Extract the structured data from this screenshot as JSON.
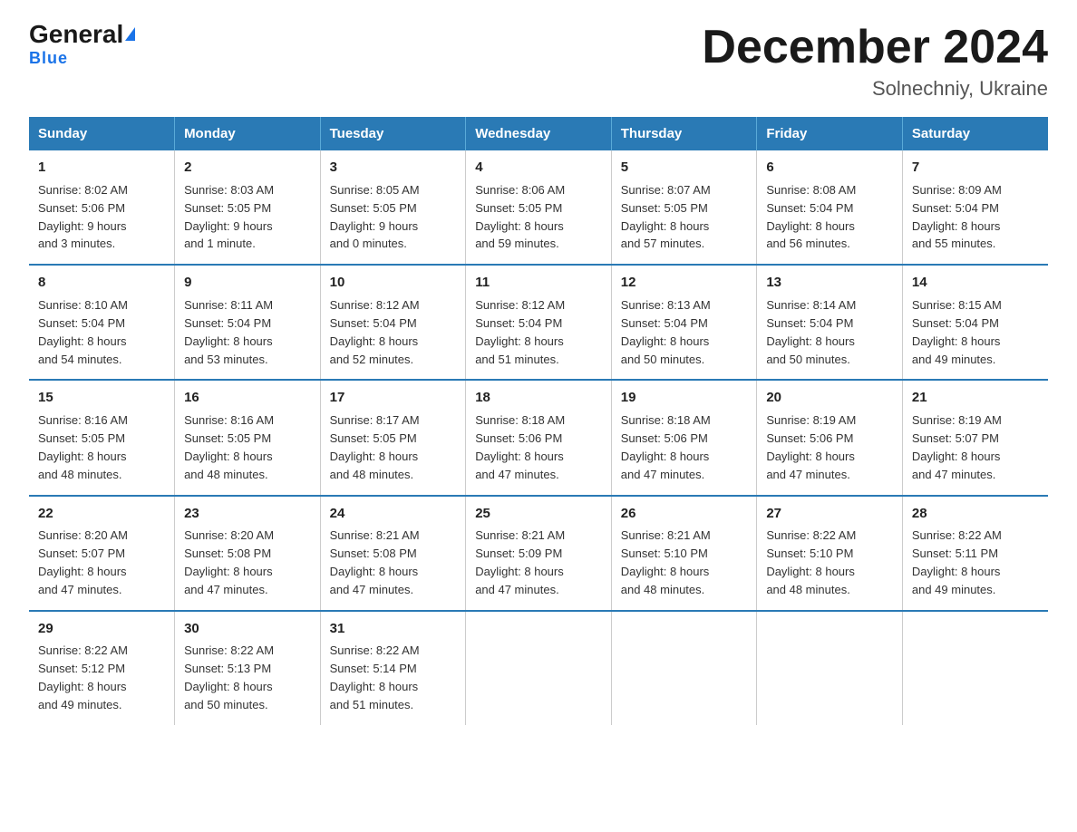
{
  "logo": {
    "general": "General",
    "triangle": "▶",
    "blue": "Blue"
  },
  "title": "December 2024",
  "subtitle": "Solnechniy, Ukraine",
  "days_header": [
    "Sunday",
    "Monday",
    "Tuesday",
    "Wednesday",
    "Thursday",
    "Friday",
    "Saturday"
  ],
  "weeks": [
    [
      {
        "day": "1",
        "sunrise": "8:02 AM",
        "sunset": "5:06 PM",
        "daylight": "9 hours and 3 minutes."
      },
      {
        "day": "2",
        "sunrise": "8:03 AM",
        "sunset": "5:05 PM",
        "daylight": "9 hours and 1 minute."
      },
      {
        "day": "3",
        "sunrise": "8:05 AM",
        "sunset": "5:05 PM",
        "daylight": "9 hours and 0 minutes."
      },
      {
        "day": "4",
        "sunrise": "8:06 AM",
        "sunset": "5:05 PM",
        "daylight": "8 hours and 59 minutes."
      },
      {
        "day": "5",
        "sunrise": "8:07 AM",
        "sunset": "5:05 PM",
        "daylight": "8 hours and 57 minutes."
      },
      {
        "day": "6",
        "sunrise": "8:08 AM",
        "sunset": "5:04 PM",
        "daylight": "8 hours and 56 minutes."
      },
      {
        "day": "7",
        "sunrise": "8:09 AM",
        "sunset": "5:04 PM",
        "daylight": "8 hours and 55 minutes."
      }
    ],
    [
      {
        "day": "8",
        "sunrise": "8:10 AM",
        "sunset": "5:04 PM",
        "daylight": "8 hours and 54 minutes."
      },
      {
        "day": "9",
        "sunrise": "8:11 AM",
        "sunset": "5:04 PM",
        "daylight": "8 hours and 53 minutes."
      },
      {
        "day": "10",
        "sunrise": "8:12 AM",
        "sunset": "5:04 PM",
        "daylight": "8 hours and 52 minutes."
      },
      {
        "day": "11",
        "sunrise": "8:12 AM",
        "sunset": "5:04 PM",
        "daylight": "8 hours and 51 minutes."
      },
      {
        "day": "12",
        "sunrise": "8:13 AM",
        "sunset": "5:04 PM",
        "daylight": "8 hours and 50 minutes."
      },
      {
        "day": "13",
        "sunrise": "8:14 AM",
        "sunset": "5:04 PM",
        "daylight": "8 hours and 50 minutes."
      },
      {
        "day": "14",
        "sunrise": "8:15 AM",
        "sunset": "5:04 PM",
        "daylight": "8 hours and 49 minutes."
      }
    ],
    [
      {
        "day": "15",
        "sunrise": "8:16 AM",
        "sunset": "5:05 PM",
        "daylight": "8 hours and 48 minutes."
      },
      {
        "day": "16",
        "sunrise": "8:16 AM",
        "sunset": "5:05 PM",
        "daylight": "8 hours and 48 minutes."
      },
      {
        "day": "17",
        "sunrise": "8:17 AM",
        "sunset": "5:05 PM",
        "daylight": "8 hours and 48 minutes."
      },
      {
        "day": "18",
        "sunrise": "8:18 AM",
        "sunset": "5:06 PM",
        "daylight": "8 hours and 47 minutes."
      },
      {
        "day": "19",
        "sunrise": "8:18 AM",
        "sunset": "5:06 PM",
        "daylight": "8 hours and 47 minutes."
      },
      {
        "day": "20",
        "sunrise": "8:19 AM",
        "sunset": "5:06 PM",
        "daylight": "8 hours and 47 minutes."
      },
      {
        "day": "21",
        "sunrise": "8:19 AM",
        "sunset": "5:07 PM",
        "daylight": "8 hours and 47 minutes."
      }
    ],
    [
      {
        "day": "22",
        "sunrise": "8:20 AM",
        "sunset": "5:07 PM",
        "daylight": "8 hours and 47 minutes."
      },
      {
        "day": "23",
        "sunrise": "8:20 AM",
        "sunset": "5:08 PM",
        "daylight": "8 hours and 47 minutes."
      },
      {
        "day": "24",
        "sunrise": "8:21 AM",
        "sunset": "5:08 PM",
        "daylight": "8 hours and 47 minutes."
      },
      {
        "day": "25",
        "sunrise": "8:21 AM",
        "sunset": "5:09 PM",
        "daylight": "8 hours and 47 minutes."
      },
      {
        "day": "26",
        "sunrise": "8:21 AM",
        "sunset": "5:10 PM",
        "daylight": "8 hours and 48 minutes."
      },
      {
        "day": "27",
        "sunrise": "8:22 AM",
        "sunset": "5:10 PM",
        "daylight": "8 hours and 48 minutes."
      },
      {
        "day": "28",
        "sunrise": "8:22 AM",
        "sunset": "5:11 PM",
        "daylight": "8 hours and 49 minutes."
      }
    ],
    [
      {
        "day": "29",
        "sunrise": "8:22 AM",
        "sunset": "5:12 PM",
        "daylight": "8 hours and 49 minutes."
      },
      {
        "day": "30",
        "sunrise": "8:22 AM",
        "sunset": "5:13 PM",
        "daylight": "8 hours and 50 minutes."
      },
      {
        "day": "31",
        "sunrise": "8:22 AM",
        "sunset": "5:14 PM",
        "daylight": "8 hours and 51 minutes."
      },
      null,
      null,
      null,
      null
    ]
  ],
  "labels": {
    "sunrise": "Sunrise:",
    "sunset": "Sunset:",
    "daylight": "Daylight:"
  }
}
